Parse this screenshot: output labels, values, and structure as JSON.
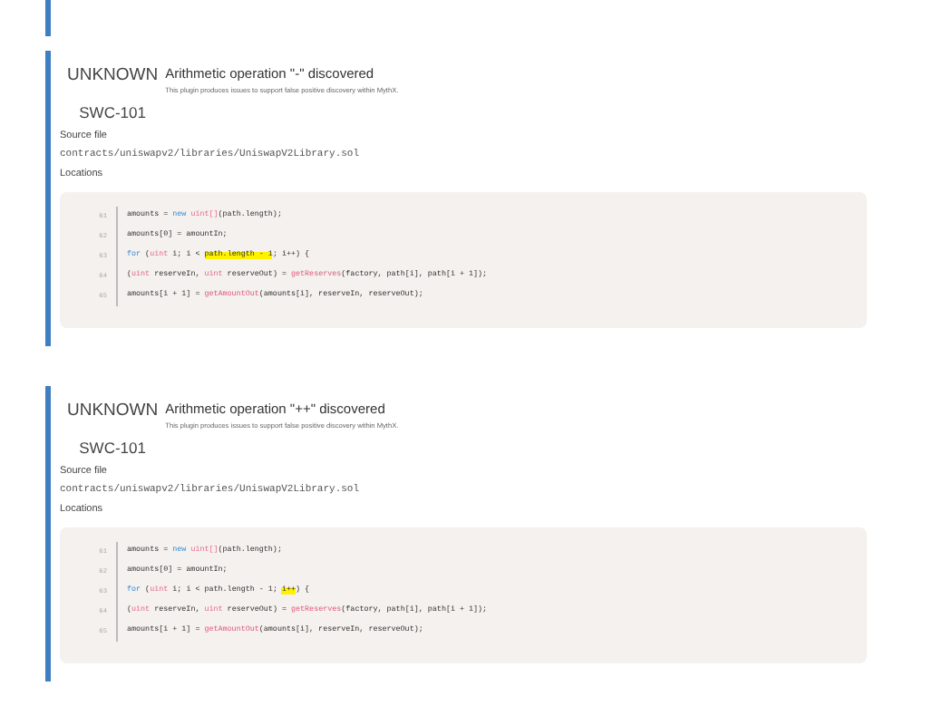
{
  "issues": [
    {
      "severity": "UNKNOWN",
      "swc": "SWC-101",
      "title": "Arithmetic operation \"-\" discovered",
      "description": "This plugin produces issues to support false positive discovery within MythX.",
      "source_label": "Source file",
      "source_file": "contracts/uniswapv2/libraries/UniswapV2Library.sol",
      "locations_label": "Locations",
      "lines": [
        {
          "number": "61",
          "tokens": [
            {
              "text": "amounts = ",
              "kind": "plain"
            },
            {
              "text": "new",
              "kind": "keyword"
            },
            {
              "text": " uint[]",
              "kind": "type"
            },
            {
              "text": "(path.length);",
              "kind": "plain"
            }
          ]
        },
        {
          "number": "62",
          "tokens": [
            {
              "text": "amounts[0] = amountIn;",
              "kind": "plain"
            }
          ]
        },
        {
          "number": "63",
          "tokens": [
            {
              "text": "for",
              "kind": "keyword"
            },
            {
              "text": " (",
              "kind": "plain"
            },
            {
              "text": "uint",
              "kind": "type"
            },
            {
              "text": " i; i < ",
              "kind": "plain"
            },
            {
              "text": "path.length - 1",
              "kind": "highlight"
            },
            {
              "text": "; i++) {",
              "kind": "plain"
            }
          ]
        },
        {
          "number": "64",
          "tokens": [
            {
              "text": "(",
              "kind": "plain"
            },
            {
              "text": "uint",
              "kind": "type"
            },
            {
              "text": " reserveIn, ",
              "kind": "plain"
            },
            {
              "text": "uint",
              "kind": "type"
            },
            {
              "text": " reserveOut) = ",
              "kind": "plain"
            },
            {
              "text": "getReserves",
              "kind": "func"
            },
            {
              "text": "(factory, path[i], path[i + 1]);",
              "kind": "plain"
            }
          ]
        },
        {
          "number": "65",
          "tokens": [
            {
              "text": "amounts[i + 1] = ",
              "kind": "plain"
            },
            {
              "text": "getAmountOut",
              "kind": "func"
            },
            {
              "text": "(amounts[i], reserveIn, reserveOut);",
              "kind": "plain"
            }
          ]
        }
      ]
    },
    {
      "severity": "UNKNOWN",
      "swc": "SWC-101",
      "title": "Arithmetic operation \"++\" discovered",
      "description": "This plugin produces issues to support false positive discovery within MythX.",
      "source_label": "Source file",
      "source_file": "contracts/uniswapv2/libraries/UniswapV2Library.sol",
      "locations_label": "Locations",
      "lines": [
        {
          "number": "61",
          "tokens": [
            {
              "text": "amounts = ",
              "kind": "plain"
            },
            {
              "text": "new",
              "kind": "keyword"
            },
            {
              "text": " uint[]",
              "kind": "type"
            },
            {
              "text": "(path.length);",
              "kind": "plain"
            }
          ]
        },
        {
          "number": "62",
          "tokens": [
            {
              "text": "amounts[0] = amountIn;",
              "kind": "plain"
            }
          ]
        },
        {
          "number": "63",
          "tokens": [
            {
              "text": "for",
              "kind": "keyword"
            },
            {
              "text": " (",
              "kind": "plain"
            },
            {
              "text": "uint",
              "kind": "type"
            },
            {
              "text": " i; i < path.length - 1; ",
              "kind": "plain"
            },
            {
              "text": "i++",
              "kind": "highlight"
            },
            {
              "text": ") {",
              "kind": "plain"
            }
          ]
        },
        {
          "number": "64",
          "tokens": [
            {
              "text": "(",
              "kind": "plain"
            },
            {
              "text": "uint",
              "kind": "type"
            },
            {
              "text": " reserveIn, ",
              "kind": "plain"
            },
            {
              "text": "uint",
              "kind": "type"
            },
            {
              "text": " reserveOut) = ",
              "kind": "plain"
            },
            {
              "text": "getReserves",
              "kind": "func"
            },
            {
              "text": "(factory, path[i], path[i + 1]);",
              "kind": "plain"
            }
          ]
        },
        {
          "number": "65",
          "tokens": [
            {
              "text": "amounts[i + 1] = ",
              "kind": "plain"
            },
            {
              "text": "getAmountOut",
              "kind": "func"
            },
            {
              "text": "(amounts[i], reserveIn, reserveOut);",
              "kind": "plain"
            }
          ]
        }
      ]
    }
  ]
}
